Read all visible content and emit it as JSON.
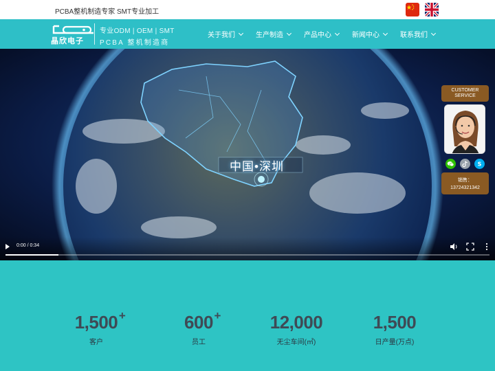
{
  "topbar": {
    "slogan": "PCBA整机制造专家 SMT专业加工",
    "flags": [
      "china-flag",
      "uk-flag"
    ]
  },
  "header": {
    "logo_text": "晶欣电子",
    "tagline_1": "专业ODM | OEM | SMT",
    "tagline_2": "PCBA 整机制造商",
    "menu": [
      {
        "label": "关于我们"
      },
      {
        "label": "生产制造"
      },
      {
        "label": "产品中心"
      },
      {
        "label": "新闻中心"
      },
      {
        "label": "联系我们"
      }
    ],
    "color": "#2ebfc7"
  },
  "video": {
    "overlay_text": "中国•深圳",
    "time": "0:00 / 0:34",
    "progress_fraction": 0.11
  },
  "customer_service": {
    "header_line1": "CUSTOMER",
    "header_line2": "SERVICE",
    "icons": [
      "wechat-icon",
      "tiktok-icon",
      "skype-icon"
    ],
    "phone_label": "销售：",
    "phone_number": "13724321342",
    "color": "#8a5a23"
  },
  "stats": {
    "items": [
      {
        "value": "1,500",
        "plus": "+",
        "label": "客户"
      },
      {
        "value": "600",
        "plus": "+",
        "label": "员工"
      },
      {
        "value": "12,000",
        "plus": "",
        "label": "无尘车间(㎡)"
      },
      {
        "value": "1,500",
        "plus": "",
        "label": "日产量(万点)"
      }
    ],
    "color": "#2ec4c4"
  }
}
